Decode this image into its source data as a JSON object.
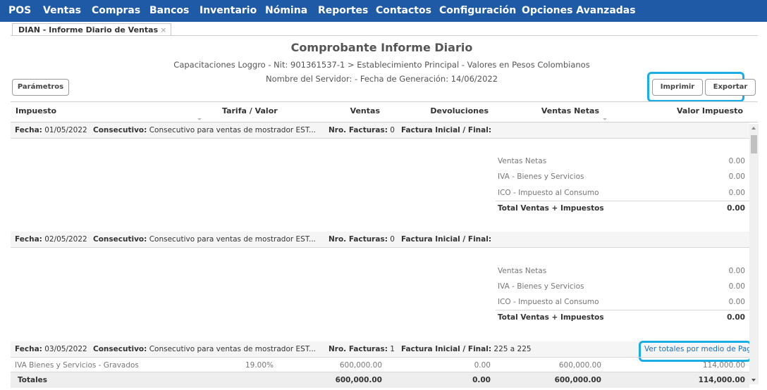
{
  "nav": {
    "items": [
      "POS",
      "Ventas",
      "Compras",
      "Bancos",
      "Inventario",
      "Nómina",
      "Reportes",
      "Contactos",
      "Configuración",
      "Opciones Avanzadas"
    ]
  },
  "tab": {
    "label": "DIAN - Informe Diario de Ventas",
    "close": "×"
  },
  "report": {
    "title": "Comprobante Informe Diario",
    "subtitle1": "Capacitaciones Loggro - Nit: 901361537-1 > Establecimiento Principal - Valores en Pesos Colombianos",
    "subtitle2": "Nombre del Servidor: - Fecha de Generación: 14/06/2022"
  },
  "buttons": {
    "parametros": "Parámetros",
    "imprimir": "Imprimir",
    "exportar": "Exportar"
  },
  "columns": [
    "Impuesto",
    "Tarifa / Valor",
    "Ventas",
    "Devoluciones",
    "Ventas Netas",
    "Valor Impuesto"
  ],
  "labels": {
    "fecha": "Fecha:",
    "consecutivo": "Consecutivo:",
    "nro_facturas": "Nro. Facturas:",
    "factura_inicial_final": "Factura Inicial / Final:",
    "ventas_netas": "Ventas Netas",
    "iva": "IVA - Bienes y Servicios",
    "ico": "ICO - Impuesto al Consumo",
    "total_ventas_impuestos": "Total Ventas + Impuestos",
    "totales": "Totales",
    "ver_totales_link": "Ver totales por medio de Pago"
  },
  "groups": [
    {
      "fecha": "01/05/2022",
      "consecutivo": "Consecutivo para ventas de mostrador EST...",
      "nro_facturas": "0",
      "factura_rango": "",
      "summary": {
        "ventas_netas": "0.00",
        "iva": "0.00",
        "ico": "0.00",
        "total": "0.00"
      }
    },
    {
      "fecha": "02/05/2022",
      "consecutivo": "Consecutivo para ventas de mostrador EST...",
      "nro_facturas": "0",
      "factura_rango": "",
      "summary": {
        "ventas_netas": "0.00",
        "iva": "0.00",
        "ico": "0.00",
        "total": "0.00"
      }
    },
    {
      "fecha": "03/05/2022",
      "consecutivo": "Consecutivo para ventas de mostrador EST...",
      "nro_facturas": "1",
      "factura_rango": "225 a 225",
      "detail": {
        "impuesto": "IVA Bienes y Servicios - Gravados",
        "tarifa": "19.00%",
        "ventas": "600,000.00",
        "devoluciones": "0.00",
        "ventas_netas": "600,000.00",
        "valor_impuesto": "114,000.00"
      },
      "totales": {
        "ventas": "600,000.00",
        "devoluciones": "0.00",
        "ventas_netas": "600,000.00",
        "valor_impuesto": "114,000.00"
      }
    }
  ],
  "colors": {
    "nav_bg": "#1f5aa6",
    "highlight": "#1aaee8",
    "link": "#1f6fb4"
  }
}
